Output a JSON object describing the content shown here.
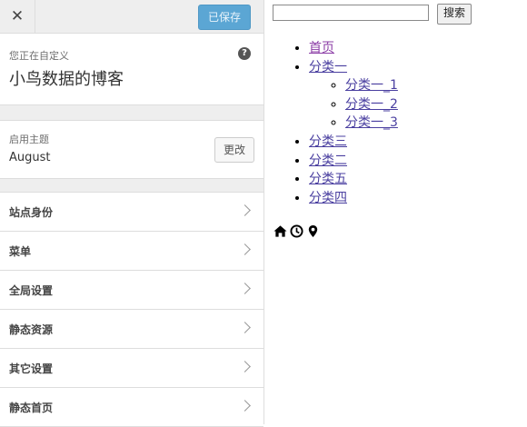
{
  "panel": {
    "close_glyph": "✕",
    "save_label": "已保存",
    "info_sub": "您正在自定义",
    "site_title": "小鸟数据的博客",
    "help_glyph": "?",
    "theme_sub": "启用主题",
    "theme_name": "August",
    "change_label": "更改",
    "sections": [
      {
        "label": "站点身份"
      },
      {
        "label": "菜单"
      },
      {
        "label": "全局设置"
      },
      {
        "label": "静态资源"
      },
      {
        "label": "其它设置"
      },
      {
        "label": "静态首页"
      }
    ]
  },
  "preview": {
    "search_value": "",
    "search_button": "搜索",
    "menu": [
      {
        "label": "首页"
      },
      {
        "label": "分类一",
        "children": [
          {
            "label": "分类一_1"
          },
          {
            "label": "分类一_2"
          },
          {
            "label": "分类一_3"
          }
        ]
      },
      {
        "label": "分类三"
      },
      {
        "label": "分类二"
      },
      {
        "label": "分类五"
      },
      {
        "label": "分类四"
      }
    ],
    "icons": [
      "home-icon",
      "clock-icon",
      "map-marker-icon"
    ]
  },
  "colors": {
    "accent": "#5ba6d4",
    "link": "#4a3fa0",
    "visited_link": "#8b3ca6"
  }
}
